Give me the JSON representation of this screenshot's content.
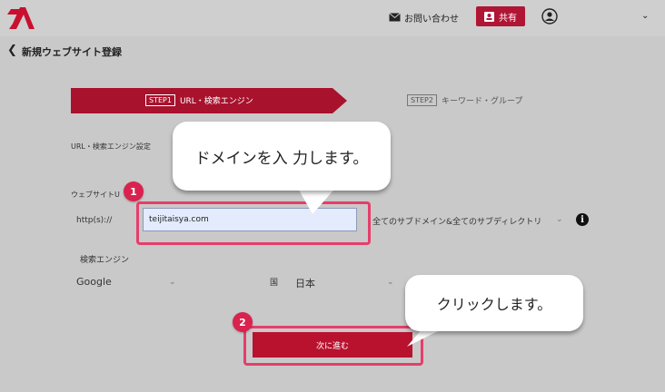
{
  "header": {
    "contact_label": "お問い合わせ",
    "share_label": "共有"
  },
  "page": {
    "back_icon": "chevron-left-icon",
    "title": "新規ウェブサイト登録"
  },
  "stepper": {
    "step1_badge": "STEP1",
    "step1_label": "URL・検索エンジン",
    "step2_badge": "STEP2",
    "step2_label": "キーワード・グループ"
  },
  "form": {
    "section_label": "URL・検索エンジン設定",
    "website_label": "ウェブサイトU",
    "protocol_label": "http(s)://",
    "domain_value": "teijitaisya.com",
    "scope_value": "全てのサブドメイン&全てのサブディレクトリ",
    "engine_label": "検索エンジン",
    "engine_value": "Google",
    "country_icon_label": "国",
    "country_value": "日本",
    "next_label": "次に進む"
  },
  "callouts": {
    "step1_marker": "1",
    "step1_text": "ドメインを入 力します。",
    "step2_marker": "2",
    "step2_text": "クリックします。"
  },
  "colors": {
    "brand": "#b01535",
    "highlight": "#e73d6b",
    "marker": "#d9224e"
  }
}
